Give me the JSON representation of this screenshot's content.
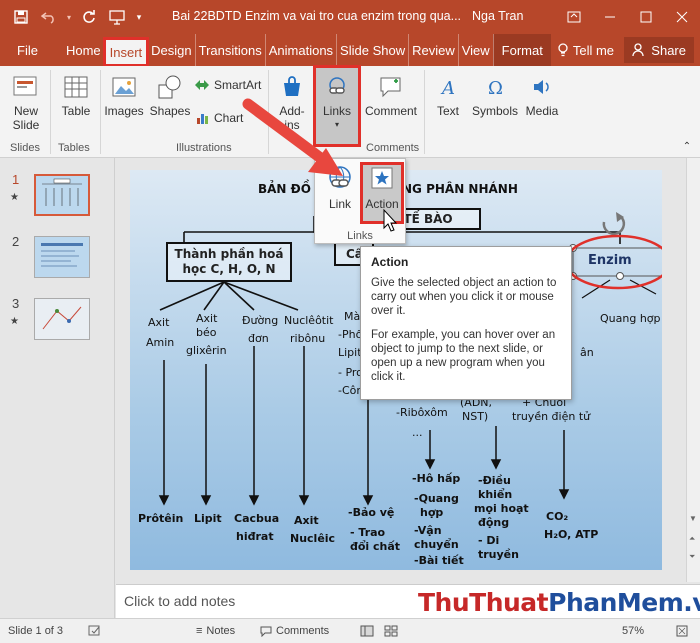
{
  "titlebar": {
    "title": "Bai 22BDTD Enzim va vai tro cua enzim trong qua...",
    "user": "Nga Tran"
  },
  "tabs": [
    {
      "label": "File"
    },
    {
      "label": "Home"
    },
    {
      "label": "Insert"
    },
    {
      "label": "Design"
    },
    {
      "label": "Transitions"
    },
    {
      "label": "Animations"
    },
    {
      "label": "Slide Show"
    },
    {
      "label": "Review"
    },
    {
      "label": "View"
    },
    {
      "label": "Format"
    }
  ],
  "tell_me": "Tell me",
  "share": "Share",
  "ribbon": {
    "new_slide_1": "New",
    "new_slide_2": "Slide",
    "table": "Table",
    "images": "Images",
    "shapes": "Shapes",
    "smartart": "SmartArt",
    "chart": "Chart",
    "addins_1": "Add-",
    "addins_2": "ins",
    "links": "Links",
    "comment": "Comment",
    "text": "Text",
    "symbols": "Symbols",
    "media": "Media",
    "groups": {
      "slides": "Slides",
      "tables": "Tables",
      "illustrations": "Illustrations",
      "comments": "Comments"
    }
  },
  "thumbnails": [
    {
      "num": "1"
    },
    {
      "num": "2"
    },
    {
      "num": "3"
    }
  ],
  "dropdown": {
    "link": "Link",
    "action": "Action",
    "group": "Links"
  },
  "tooltip": {
    "title": "Action",
    "p1": "Give the selected object an action to carry out when you click it or mouse over it.",
    "p2": "For example, you can hover over an object to jump to the next slide, or open up a new program when you click it."
  },
  "slide": {
    "title_left": "BẢN ĐỒ",
    "title_right": "NG PHÂN NHÁNH",
    "center": "TẾ BÀO",
    "composition_1": "Thành phần hoá",
    "composition_2": "học C, H, O, N",
    "structure": "Cấ",
    "enzim": "Enzim",
    "quang_hop": "Quang hợp",
    "axit_amin_1": "Axit",
    "axit_amin_2": "Amin",
    "axit_beo_1": "Axit",
    "axit_beo_2": "béo",
    "axit_beo_3": "glixêrin",
    "duong_1": "Đường",
    "duong_2": "đơn",
    "nucleotit_1": "Nuclêôtit",
    "nucleotit_2": "ribônu",
    "ma": "Mà",
    "pho": "-Phố",
    "lipit_short": "Lipit",
    "pro": "- Pro",
    "co": "-Côn",
    "an": "ân",
    "ribosom": "-Ribôxôm",
    "dots": "...",
    "adn_1": "(ADN,",
    "adn_2": "NST)",
    "chuoi_1": "+ Chuỗi",
    "chuoi_2": "truyền điện tử",
    "protein": "Prôtêin",
    "lipit": "Lipit",
    "cacbua_1": "Cacbua",
    "cacbua_2": "hiđrat",
    "axit_nucleic_1": "Axit",
    "axit_nucleic_2": "Nuclêic",
    "bao_ve": "-Bảo vệ",
    "trao_doi_1": "- Trao",
    "trao_doi_2": "đổi chất",
    "ho_hap": "-Hô hấp",
    "quang_hop_2_1": "-Quang",
    "quang_hop_2_2": "hợp",
    "van_chuyen_1": "-Vận",
    "van_chuyen_2": "chuyển",
    "bai_tiet": "-Bài tiết",
    "dieu_khien_1": "-Điều",
    "dieu_khien_2": "khiển",
    "dieu_khien_3": "mọi hoạt",
    "dieu_khien_4": "động",
    "di_truyen_1": "- Di",
    "di_truyen_2": "truyền",
    "co2": "CO₂",
    "h2o": "H₂O, ATP"
  },
  "notes_placeholder": "Click to add notes",
  "statusbar": {
    "slide_info": "Slide 1 of 3",
    "notes": "Notes",
    "comments": "Comments",
    "zoom": "57%"
  },
  "watermark": {
    "part1": "ThuThuat",
    "part2": "PhanMem",
    "part3": ".vn"
  },
  "colors": {
    "accent": "#b7472a",
    "highlight": "#e0302a"
  }
}
